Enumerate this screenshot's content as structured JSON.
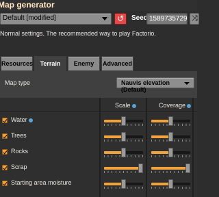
{
  "window": {
    "title": "Map generator"
  },
  "preset": {
    "value": "Default [modified]"
  },
  "seed": {
    "label": "Seed",
    "value": "1589735729"
  },
  "description": "Normal settings. The recommended way to play Factorio.",
  "tabs": [
    {
      "label": "Resources",
      "active": false
    },
    {
      "label": "Terrain",
      "active": true
    },
    {
      "label": "Enemy",
      "active": false
    },
    {
      "label": "Advanced",
      "active": false
    }
  ],
  "map_type": {
    "label": "Map type",
    "value": "Nauvis elevation (Default)"
  },
  "columns": {
    "scale": "Scale",
    "coverage": "Coverage"
  },
  "rows": [
    {
      "label": "Water",
      "checked": true,
      "has_info": true,
      "scale": 0.5,
      "coverage": 0.5
    },
    {
      "label": "Trees",
      "checked": true,
      "has_info": false,
      "scale": 0.5,
      "coverage": 0.5
    },
    {
      "label": "Rocks",
      "checked": true,
      "has_info": false,
      "scale": 0.5,
      "coverage": 0.5
    },
    {
      "label": "Scrap",
      "checked": true,
      "has_info": false,
      "scale": 1.0,
      "coverage": 1.0
    },
    {
      "label": "Starting area moisture",
      "checked": true,
      "has_info": false,
      "scale": 0.5,
      "coverage": 0.5
    }
  ],
  "colors": {
    "accent": "#f0a23c",
    "reset": "#e44848",
    "panel": "#414040"
  }
}
